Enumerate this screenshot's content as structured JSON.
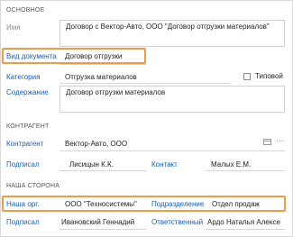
{
  "main": {
    "section_title": "ОСНОВНОЕ",
    "name_label": "Имя",
    "name_value": "Договор с Вектор-Авто, ООО \"Договор отгрузки материалов\"",
    "doc_type_label": "Вид документа",
    "doc_type_value": "Договор отгрузки",
    "category_label": "Категория",
    "category_value": "Отгрузка материалов",
    "typical_label": "Типовой",
    "content_label": "Содержание",
    "content_value": "Договор отгрузки материалов"
  },
  "counterparty": {
    "section_title": "КОНТРАГЕНТ",
    "counterparty_label": "Контрагент",
    "counterparty_value": "Вектор-Авто, ООО",
    "signed_label": "Подписал",
    "signed_value": "Лисицын К.К.",
    "contact_label": "Контакт",
    "contact_value": "Малых Е.М."
  },
  "our_side": {
    "section_title": "НАША СТОРОНА",
    "org_label": "Наша орг.",
    "org_value": "ООО \"Техносистемы\"",
    "division_label": "Подразделение",
    "division_value": "Отдел продаж",
    "signed_label": "Подписал",
    "signed_value": "Ивановский Геннадий",
    "responsible_label": "Ответственный",
    "responsible_value": "Ардо Наталья Алексе"
  },
  "icons": {
    "card": "card-icon",
    "more": "more-icon"
  },
  "colors": {
    "highlight": "#f29a4a",
    "link": "#1a5fb4"
  }
}
